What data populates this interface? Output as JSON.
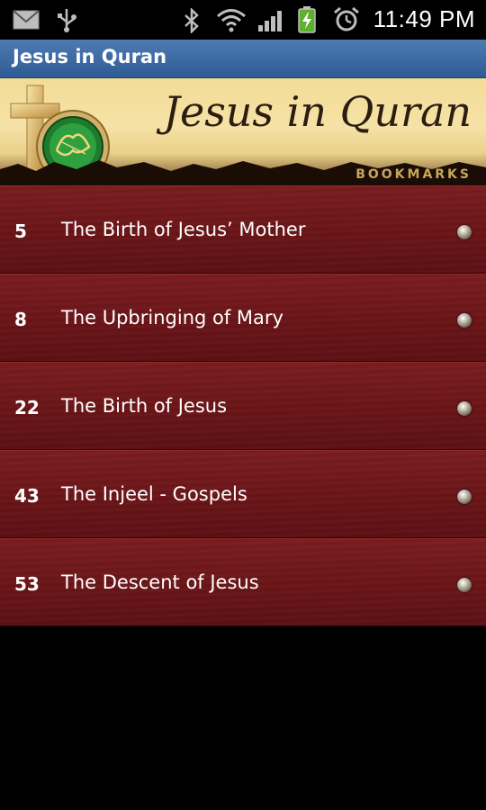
{
  "status_bar": {
    "time": "11:49 PM",
    "icons": [
      "mail-icon",
      "usb-icon",
      "bluetooth-icon",
      "wifi-icon",
      "signal-icon",
      "battery-icon",
      "alarm-icon"
    ]
  },
  "app": {
    "title": "Jesus in Quran"
  },
  "banner": {
    "title": "Jesus in Quran",
    "subtitle": "BOOKMARKS"
  },
  "bookmarks": [
    {
      "number": "5",
      "title": "The Birth of Jesus’ Mother"
    },
    {
      "number": "8",
      "title": "The Upbringing of Mary"
    },
    {
      "number": "22",
      "title": "The Birth of Jesus"
    },
    {
      "number": "43",
      "title": "The Injeel - Gospels"
    },
    {
      "number": "53",
      "title": "The Descent of Jesus"
    }
  ],
  "colors": {
    "title_bar": "#3d6aa6",
    "list_background": "#6a1417",
    "banner_background": "#f3dc97"
  }
}
